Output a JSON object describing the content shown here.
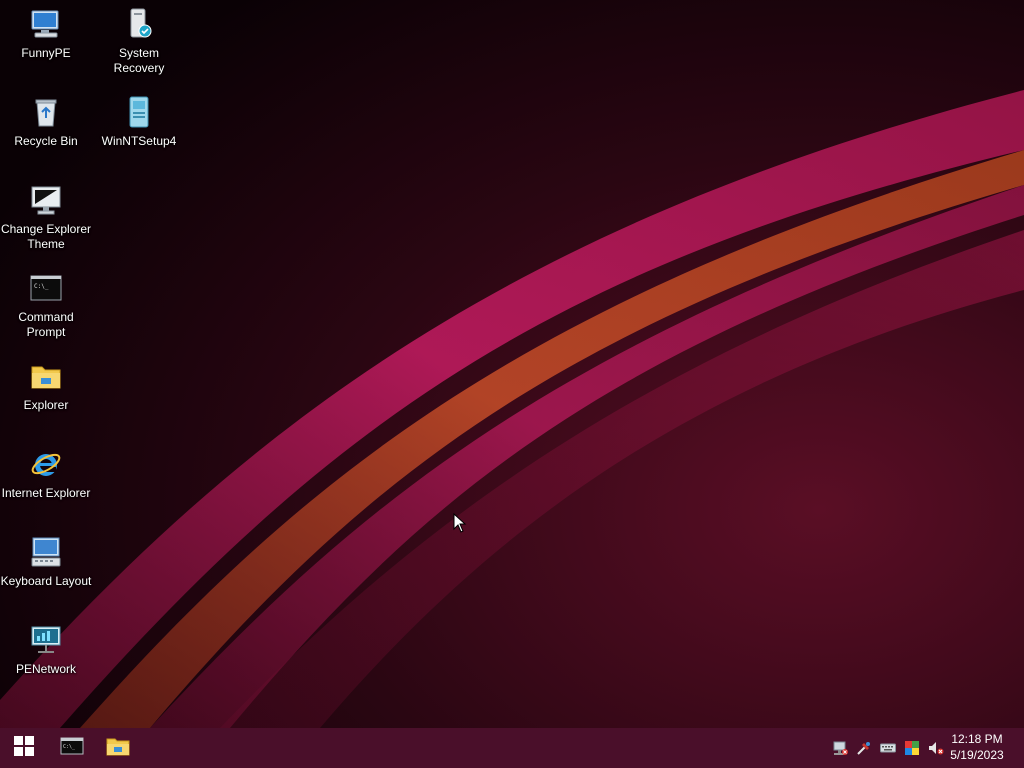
{
  "desktop": {
    "icons": [
      {
        "label": "FunnyPE",
        "icon": "computer-icon"
      },
      {
        "label": "System Recovery",
        "icon": "system-recovery-icon"
      },
      {
        "label": "Recycle Bin",
        "icon": "recycle-bin-icon"
      },
      {
        "label": "WinNTSetup4",
        "icon": "winntsetup-icon"
      },
      {
        "label": "Change Explorer Theme",
        "icon": "monitor-theme-icon"
      },
      {
        "label": "Command Prompt",
        "icon": "command-prompt-icon"
      },
      {
        "label": "Explorer",
        "icon": "folder-icon"
      },
      {
        "label": "Internet Explorer",
        "icon": "internet-explorer-icon"
      },
      {
        "label": "Keyboard Layout",
        "icon": "keyboard-layout-icon"
      },
      {
        "label": "PENetwork",
        "icon": "network-icon"
      }
    ]
  },
  "taskbar": {
    "start_icon": "windows-logo-icon",
    "pinned": [
      "command-prompt-icon",
      "file-explorer-icon"
    ],
    "tray": [
      "network-disconnected-icon",
      "tools-icon",
      "keyboard-icon",
      "color-icon",
      "volume-muted-icon"
    ],
    "clock": {
      "time": "12:18 PM",
      "date": "5/19/2023"
    }
  },
  "colors": {
    "taskbar": "#4a0f2a",
    "wallpaper_dark": "#12030a",
    "accent_pink": "#b8185a",
    "accent_orange": "#c94a24"
  }
}
